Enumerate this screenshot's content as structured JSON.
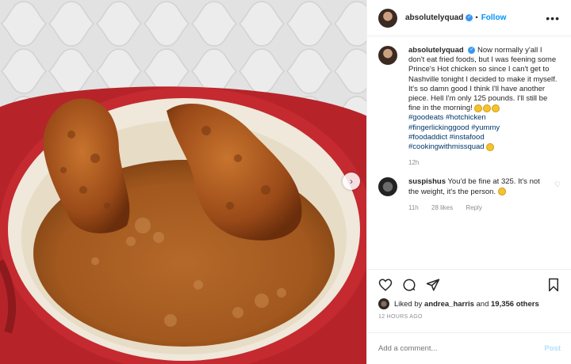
{
  "post": {
    "author": "absolutelyquad",
    "follow_label": "Follow",
    "more_label": "•••",
    "caption": {
      "author": "absolutelyquad",
      "text": "Now normally y'all I don't eat fried foods, but I was feening some Prince's Hot chicken so since I can't get to Nashville tonight I decided to make it myself. It's so damn good I think I'll have another piece. Hell I'm only 125 pounds. I'll still be fine in the morning!",
      "hashtags": [
        "#goodeats",
        "#hotchicken",
        "#fingerlickinggood",
        "#yummy",
        "#foodaddict",
        "#instafood",
        "#cookingwithmissquad"
      ],
      "time": "12h"
    },
    "comment": {
      "author": "suspishus",
      "text": "You'd be fine at 325. It's not the weight, it's the person.",
      "time": "11h",
      "likes": "28 likes",
      "reply_label": "Reply"
    },
    "likes": {
      "prefix": "Liked by",
      "user": "andrea_harris",
      "middle": "and",
      "count": "19,356 others"
    },
    "timestamp": "12 HOURS AGO",
    "add_comment_placeholder": "Add a comment...",
    "post_button": "Post"
  },
  "colors": {
    "link_blue": "#0095f6",
    "hashtag": "#00376b",
    "muted": "#8e8e8e"
  },
  "icons": [
    "heart-icon",
    "comment-icon",
    "share-icon",
    "bookmark-icon",
    "next-arrow-icon",
    "verified-badge-icon",
    "more-options-icon"
  ]
}
